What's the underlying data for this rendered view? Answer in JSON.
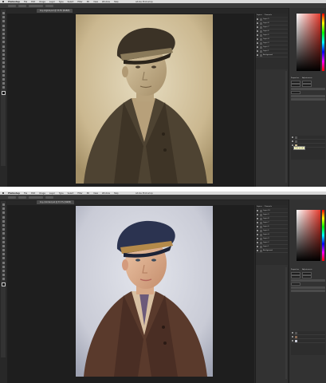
{
  "before": {
    "menubar": {
      "app_name": "Photoshop",
      "menus": [
        "File",
        "Edit",
        "Image",
        "Layer",
        "Type",
        "Select",
        "Filter",
        "3D",
        "View",
        "Window",
        "Help"
      ],
      "window_title": "Adobe Photoshop"
    },
    "document_tab": "boy-original.psd @ 33.3% (RGB/8)",
    "layers": [
      "Background",
      "Layer 1",
      "Layer 2",
      "Layer 3",
      "Layer 4",
      "Layer 5",
      "Layer 6",
      "Layer 7",
      "Layer 8",
      "Layer 9"
    ],
    "panel_tabs": [
      "Layers",
      "Channels",
      "Paths"
    ],
    "properties_tabs": [
      "Properties",
      "Adjustments"
    ],
    "tooltip": "Click to edit",
    "colors": {
      "photo_tone": "#cbb890",
      "ps_bg": "#282828",
      "accent_red": "#e53b2e"
    }
  },
  "after": {
    "menubar": {
      "app_name": "Photoshop",
      "menus": [
        "File",
        "Edit",
        "Image",
        "Layer",
        "Type",
        "Select",
        "Filter",
        "3D",
        "View",
        "Window",
        "Help"
      ],
      "window_title": "Adobe Photoshop"
    },
    "document_tab": "boy-colorized.psd @ 33.3% (RGB/8)",
    "layers": [
      "Background",
      "Layer 1",
      "Layer 2",
      "Layer 3",
      "Layer 4",
      "Layer 5",
      "Layer 6",
      "Layer 7",
      "Layer 8",
      "Layer 9",
      "Layer 10"
    ],
    "panel_tabs": [
      "Layers",
      "Channels",
      "Paths"
    ],
    "properties_tabs": [
      "Properties",
      "Adjustments"
    ],
    "colors": {
      "cap": "#2b3350",
      "jacket": "#5a3a2c",
      "bg": "#c9cbd6"
    }
  }
}
